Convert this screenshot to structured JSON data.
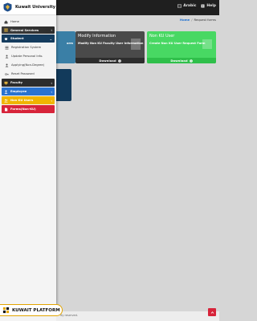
{
  "topbar": {
    "arabic_label": "Arabic",
    "help_label": "Help"
  },
  "breadcrumb": {
    "home": "Home",
    "separator": "/",
    "current": "Request forms"
  },
  "cards": {
    "blue": {
      "title": "",
      "sub": "orm"
    },
    "modify": {
      "title": "Modify Information",
      "sub": "Modify Non KU Faculty User Information",
      "action": "Download"
    },
    "nonku": {
      "title": "Non KU User",
      "sub": "Create Non KU User Request Form",
      "action": "Download"
    }
  },
  "brand": {
    "name": "Kuwait University"
  },
  "sidebar": {
    "items": [
      {
        "label": "Home"
      },
      {
        "label": "General Services"
      },
      {
        "label": "Student"
      },
      {
        "label": "Registration System"
      },
      {
        "label": "Update Personal Info."
      },
      {
        "label": "Applying(Non-Degree)"
      },
      {
        "label": "Reset Password"
      },
      {
        "label": "Faculty"
      },
      {
        "label": "Employee"
      },
      {
        "label": "Non KU Users"
      },
      {
        "label": "Forms(Non-KU)"
      }
    ]
  },
  "platform": {
    "label": "KUWAIT PLATFORM"
  },
  "footer": {
    "copyright": "ity reserved."
  },
  "colors": {
    "student": "#153c5e",
    "employee": "#2a73d0",
    "nonku": "#f0b400",
    "forms": "#d7243a",
    "card_green": "#48d863"
  }
}
